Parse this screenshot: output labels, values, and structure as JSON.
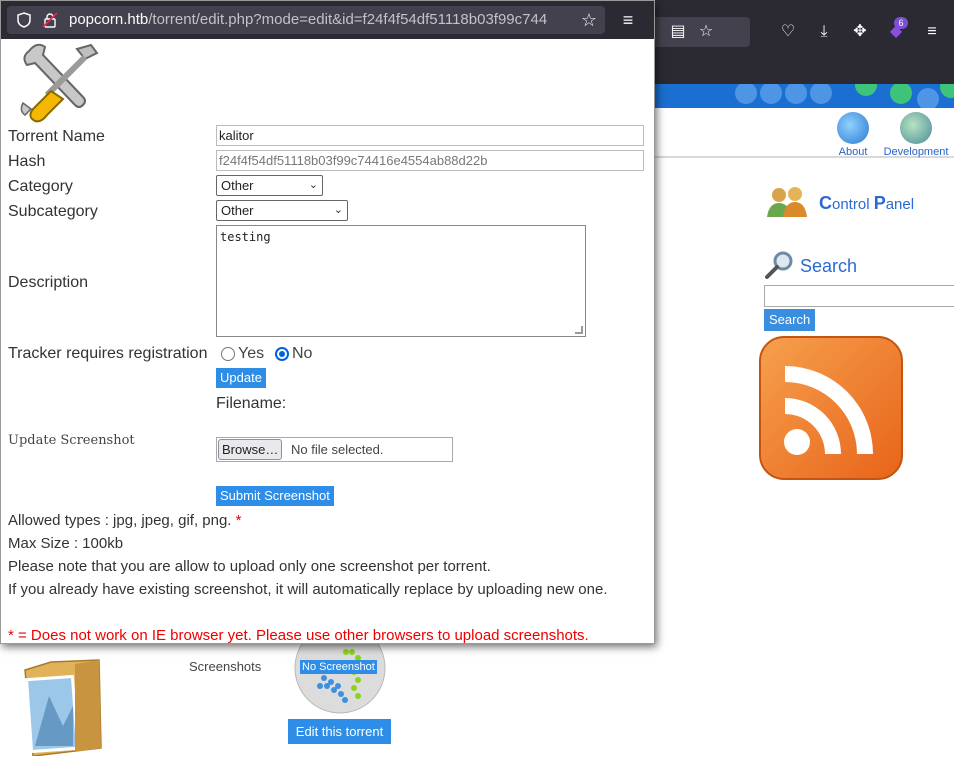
{
  "background_browser": {
    "extensions_badge": "6",
    "nav": {
      "about": "About",
      "development": "Development"
    },
    "control_panel": {
      "c": "C",
      "rest1": "ontrol ",
      "p": "P",
      "rest2": "anel"
    },
    "search": {
      "title": "Search",
      "button": "Search",
      "input_value": ""
    }
  },
  "bottom": {
    "screenshots_label": "Screenshots",
    "no_screenshot_label": "No Screenshot",
    "edit_button": "Edit this torrent"
  },
  "popup": {
    "url_host": "popcorn.htb",
    "url_path": "/torrent/edit.php?mode=edit&id=f24f4f54df51118b03f99c744",
    "form": {
      "torrent_name_label": "Torrent Name",
      "torrent_name_value": "kalitor",
      "hash_label": "Hash",
      "hash_value": "f24f4f54df51118b03f99c74416e4554ab88d22b",
      "category_label": "Category",
      "category_value": "Other",
      "subcategory_label": "Subcategory",
      "subcategory_value": "Other",
      "description_label": "Description",
      "description_value": "testing",
      "tracker_label": "Tracker requires registration",
      "tracker_yes": "Yes",
      "tracker_no": "No",
      "tracker_selected": "No",
      "update_button": "Update",
      "filename_label": "Filename:",
      "update_screenshot_label": "Update Screenshot",
      "browse_button": "Browse…",
      "no_file_text": "No file selected.",
      "submit_screenshot_button": "Submit Screenshot"
    },
    "info": {
      "allowed_types": "Allowed types : jpg, jpeg, gif, png.",
      "required_mark": "*",
      "max_size": "Max Size : 100kb",
      "note_one": "Please note that you are allow to upload only one screenshot per torrent.",
      "note_replace": "If you already have existing screenshot, it will automatically replace by uploading new one.",
      "warning": "* = Does not work on IE browser yet. Please use other browsers to upload screenshots."
    }
  },
  "colors": {
    "accent_blue": "#2e8de6",
    "firefox_toolbar": "#2b2a33",
    "warning_red": "#e00000",
    "link_blue": "#2a6ad2"
  }
}
